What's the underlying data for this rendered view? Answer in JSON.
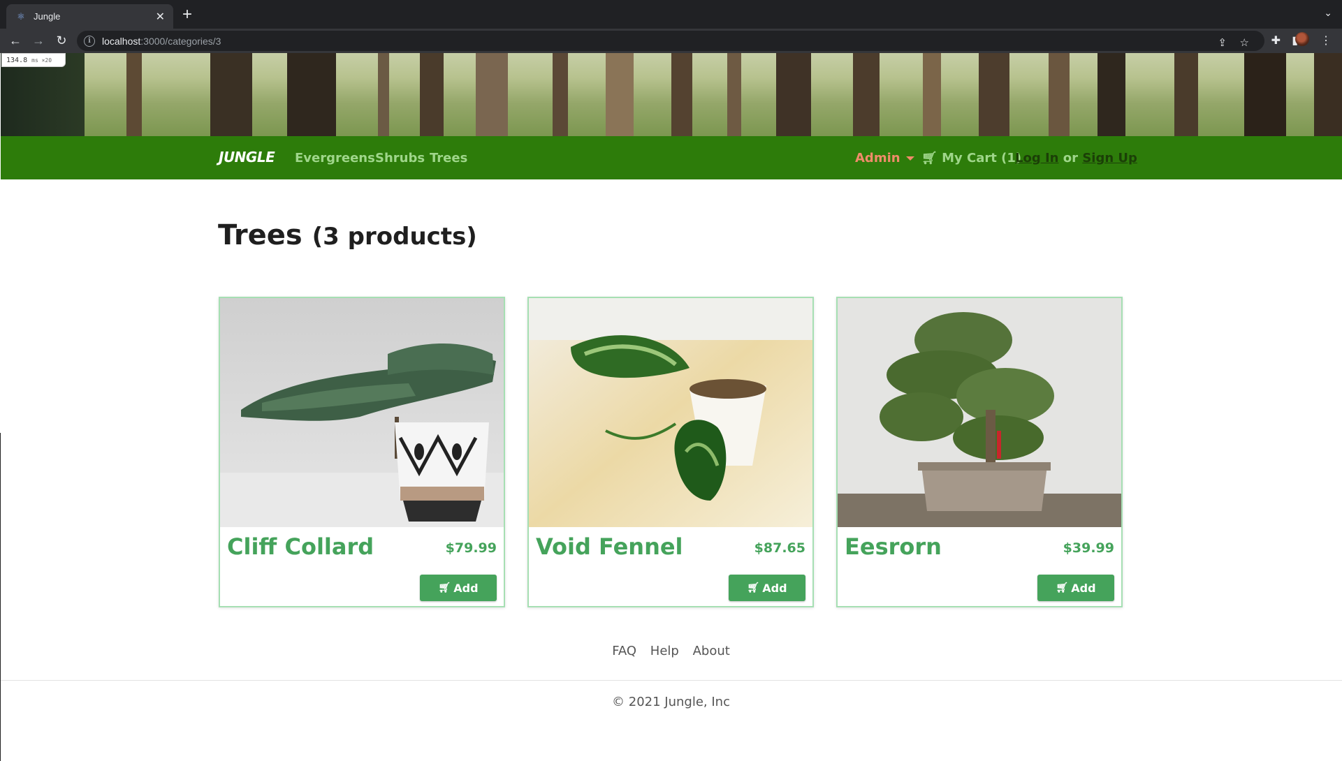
{
  "browser": {
    "tab_title": "Jungle",
    "url_host": "localhost",
    "url_path": ":3000/categories/3"
  },
  "perf_badge": {
    "value": "134.8",
    "unit": "ms ×20"
  },
  "site": {
    "brand": "JUNGLE",
    "nav": [
      "Evergreens",
      "Shrubs",
      "Trees"
    ],
    "admin_label": "Admin",
    "cart_label": "My Cart (1)",
    "login_label": "Log In",
    "or_label": "or",
    "signup_label": "Sign Up"
  },
  "category": {
    "name": "Trees",
    "count_label": "(3 products)"
  },
  "products": [
    {
      "name": "Cliff Collard",
      "price": "$79.99",
      "add_label": "Add"
    },
    {
      "name": "Void Fennel",
      "price": "$87.65",
      "add_label": "Add"
    },
    {
      "name": "Eesrorn",
      "price": "$39.99",
      "add_label": "Add"
    }
  ],
  "footer": {
    "links": [
      "FAQ",
      "Help",
      "About"
    ],
    "copyright": "© 2021 Jungle, Inc"
  },
  "colors": {
    "navbar": "#2d7c0a",
    "nav_link": "#9fd68a",
    "admin": "#f08c6a",
    "product_green": "#45a35b",
    "card_border": "#a6dfb3"
  },
  "icons": {
    "tab_favicon": "react-atom-icon",
    "add_button": "cart-icon",
    "cart_nav": "cart-icon"
  }
}
